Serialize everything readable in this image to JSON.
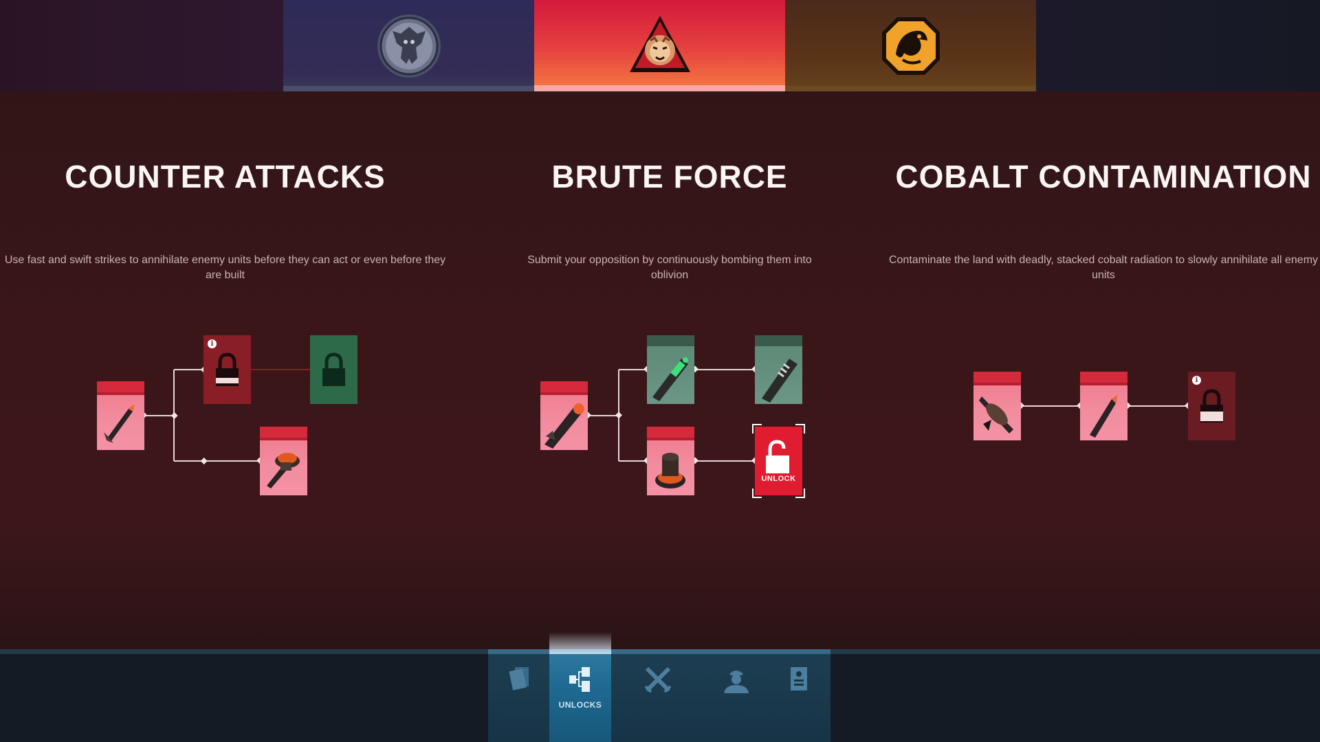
{
  "factions": {
    "tabs": [
      {
        "icon": "gargoyle-emblem-icon",
        "selected": false
      },
      {
        "icon": "lion-triangle-emblem-icon",
        "selected": true
      },
      {
        "icon": "dragon-emblem-icon",
        "selected": false
      }
    ]
  },
  "columns": [
    {
      "title": "COUNTER ATTACKS",
      "description": "Use fast and swift strikes to annihilate enemy units before they can act or even before they are built"
    },
    {
      "title": "BRUTE FORCE",
      "description": "Submit your opposition by continuously bombing them into oblivion"
    },
    {
      "title": "COBALT CONTAMINATION",
      "description": "Contaminate the land with deadly, stacked cobalt radiation to slowly annihilate all enemy units"
    }
  ],
  "unlock_node": {
    "label": "UNLOCK"
  },
  "info_glyph": "i",
  "bottom_nav": {
    "items": [
      {
        "icon": "cards-icon",
        "label": ""
      },
      {
        "icon": "unlocks-tree-icon",
        "label": "UNLOCKS",
        "active": true
      },
      {
        "icon": "crossed-swords-icon",
        "label": ""
      },
      {
        "icon": "commander-icon",
        "label": ""
      },
      {
        "icon": "dossier-icon",
        "label": ""
      }
    ]
  },
  "colors": {
    "accent_red": "#e21c30",
    "card_pink": "#f28da0",
    "teal": "#5e8a78",
    "nav_active": "#1f6a92"
  }
}
